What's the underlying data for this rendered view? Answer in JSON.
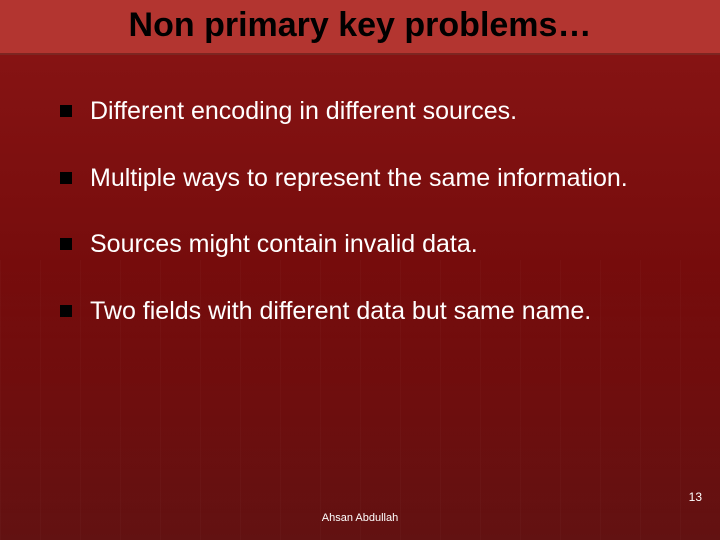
{
  "slide": {
    "title": "Non primary key problems…",
    "bullets": [
      "Different encoding in different sources.",
      "Multiple ways to represent the same information.",
      "Sources might contain invalid data.",
      "Two fields with different data but same name."
    ],
    "page_number": "13",
    "footer_author": "Ahsan Abdullah"
  }
}
